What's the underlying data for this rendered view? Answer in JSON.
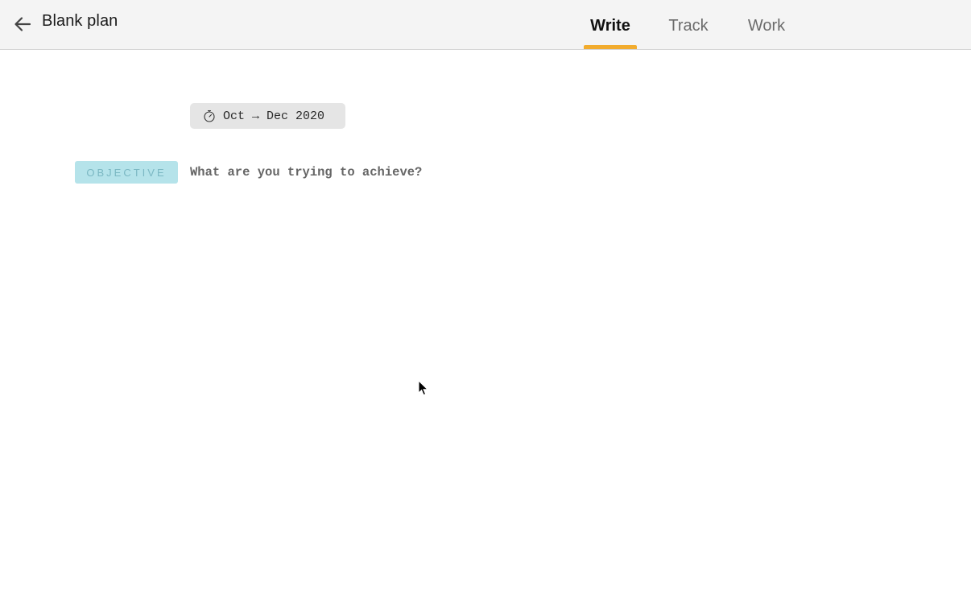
{
  "header": {
    "back_icon": "arrow-left-icon",
    "title": "Blank plan",
    "tabs": [
      {
        "label": "Write",
        "active": true
      },
      {
        "label": "Track",
        "active": false
      },
      {
        "label": "Work",
        "active": false
      }
    ],
    "active_tab_color": "#f2ac2e"
  },
  "plan": {
    "date_icon": "stopwatch-icon",
    "date_range": "Oct → Dec 2020",
    "objective_label": "OBJECTIVE",
    "objective_placeholder": "What are you trying to achieve?",
    "objective_value": "",
    "objective_color": "#b5e3ea"
  }
}
